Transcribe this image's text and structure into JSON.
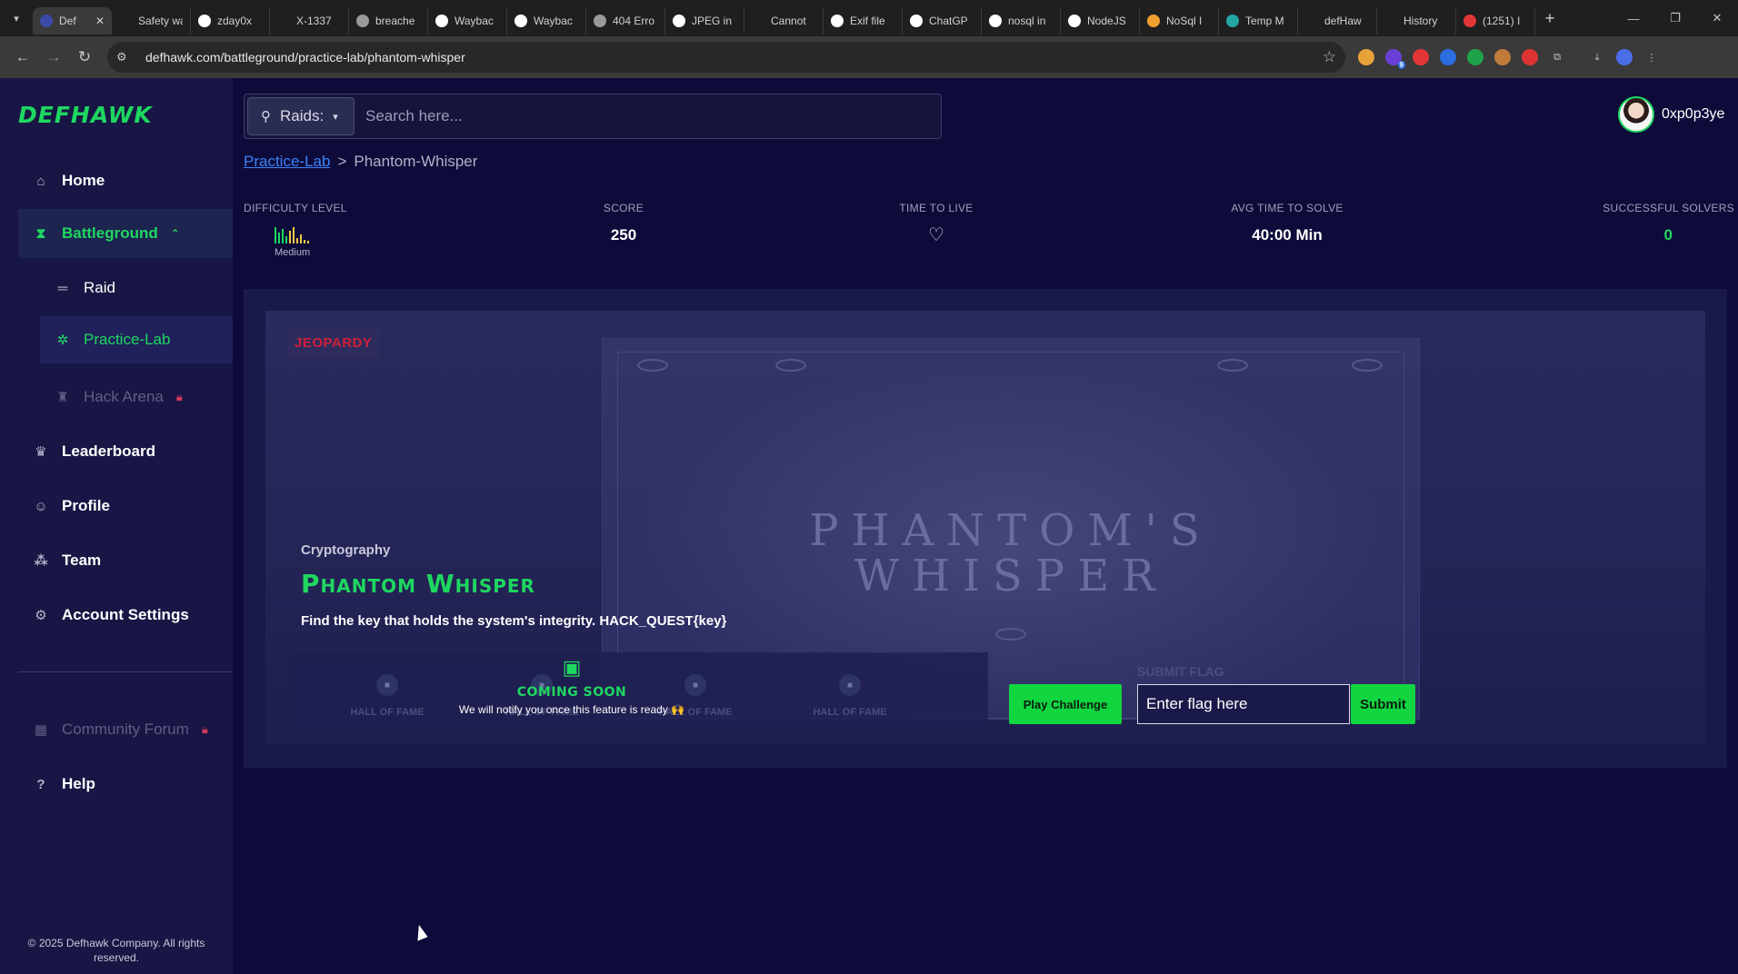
{
  "browser": {
    "tabs": [
      {
        "title": "Def",
        "fav": "#3a4aa6",
        "active": true
      },
      {
        "title": "Safety warn",
        "fav": ""
      },
      {
        "title": "zday0x",
        "fav": "#ffffff"
      },
      {
        "title": "X-1337",
        "fav": ""
      },
      {
        "title": "breache",
        "fav": "#9a9a9a"
      },
      {
        "title": "Waybac",
        "fav": "#ffffff"
      },
      {
        "title": "Waybac",
        "fav": "#ffffff"
      },
      {
        "title": "404 Erro",
        "fav": "#9a9a9a"
      },
      {
        "title": "JPEG in",
        "fav": "#ffffff"
      },
      {
        "title": "Cannot",
        "fav": ""
      },
      {
        "title": "Exif file",
        "fav": "#ffffff"
      },
      {
        "title": "ChatGP",
        "fav": "#ffffff"
      },
      {
        "title": "nosql in",
        "fav": "#ffffff"
      },
      {
        "title": "NodeJS",
        "fav": "#ffffff"
      },
      {
        "title": "NoSql I",
        "fav": "#f0a030"
      },
      {
        "title": "Temp M",
        "fav": "#22a6a6"
      },
      {
        "title": "defHaw",
        "fav": ""
      },
      {
        "title": "History",
        "fav": ""
      },
      {
        "title": "(1251) I",
        "fav": "#e23636"
      }
    ],
    "url": "defhawk.com/battleground/practice-lab/phantom-whisper",
    "extension_badge": "9"
  },
  "brand": {
    "logo": "DEFHAWK",
    "accent": "#1ed760"
  },
  "nav": {
    "home": "Home",
    "battleground": "Battleground",
    "raid": "Raid",
    "practice_lab": "Practice-Lab",
    "hack_arena": "Hack Arena",
    "leaderboard": "Leaderboard",
    "profile": "Profile",
    "team": "Team",
    "account_settings": "Account Settings",
    "community_forum": "Community Forum",
    "help": "Help"
  },
  "footer": {
    "copyright": "© 2025 Defhawk Company. All rights reserved."
  },
  "search": {
    "scope": "Raids:",
    "placeholder": "Search here..."
  },
  "user": {
    "name": "0xp0p3ye"
  },
  "breadcrumb": {
    "parent": "Practice-Lab",
    "sep": ">",
    "current": "Phantom-Whisper"
  },
  "stats": {
    "difficulty_label": "DIFFICULTY LEVEL",
    "difficulty_value": "Medium",
    "score_label": "SCORE",
    "score_value": "250",
    "ttl_label": "TIME TO LIVE",
    "avg_label": "AVG TIME TO SOLVE",
    "avg_value": "40:00 Min",
    "solvers_label": "SUCCESSFUL SOLVERS",
    "solvers_value": "0"
  },
  "challenge": {
    "badge": "JEOPARDY",
    "art_line1": "PHANTOM'S",
    "art_line2": "WHISPER",
    "category": "Cryptography",
    "title": "Phantom Whisper",
    "description": "Find the key that holds the system's integrity. HACK_QUEST{key}",
    "hall_of_fame": [
      "HALL OF FAME",
      "HALL OF FAME",
      "HALL OF FAME",
      "HALL OF FAME"
    ],
    "coming_soon_title": "COMING SOON",
    "coming_soon_sub": "We will notify you once this feature is ready 🙌",
    "play_label": "Play Challenge",
    "submit_flag_label": "SUBMIT FLAG",
    "flag_placeholder": "Enter flag here",
    "submit_label": "Submit"
  }
}
